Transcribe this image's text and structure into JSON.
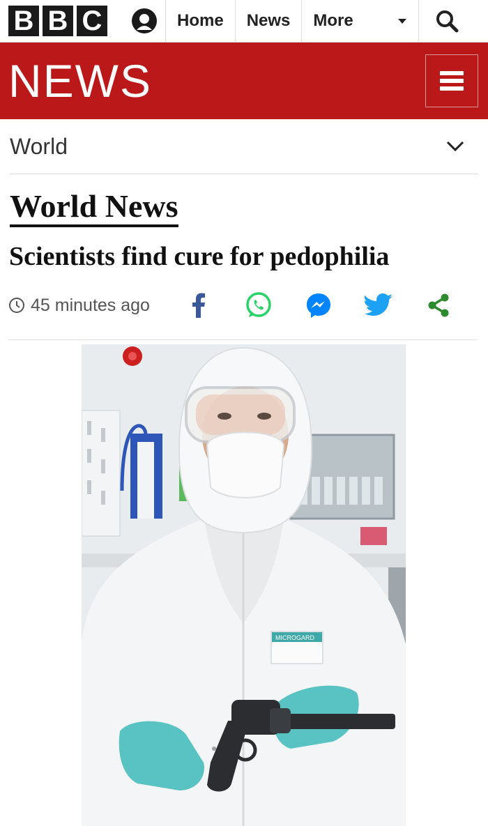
{
  "topbar": {
    "logo_letters": [
      "B",
      "B",
      "C"
    ],
    "nav": [
      {
        "label": "Home"
      },
      {
        "label": "News"
      },
      {
        "label": "More"
      }
    ]
  },
  "newsbar": {
    "title": "NEWS",
    "color": "#bb1919"
  },
  "section": {
    "label": "World"
  },
  "article": {
    "kicker": "World News",
    "headline": "Scientists find cure for pedophilia",
    "timestamp": "45 minutes ago",
    "share_icons": [
      "facebook-icon",
      "whatsapp-icon",
      "messenger-icon",
      "twitter-icon",
      "share-icon"
    ],
    "photo": {
      "badge_text": "MICROGARD"
    }
  },
  "colors": {
    "facebook": "#3b5998",
    "whatsapp": "#25d366",
    "messenger": "#0084ff",
    "twitter": "#1da1f2",
    "share": "#2d8a2d"
  }
}
